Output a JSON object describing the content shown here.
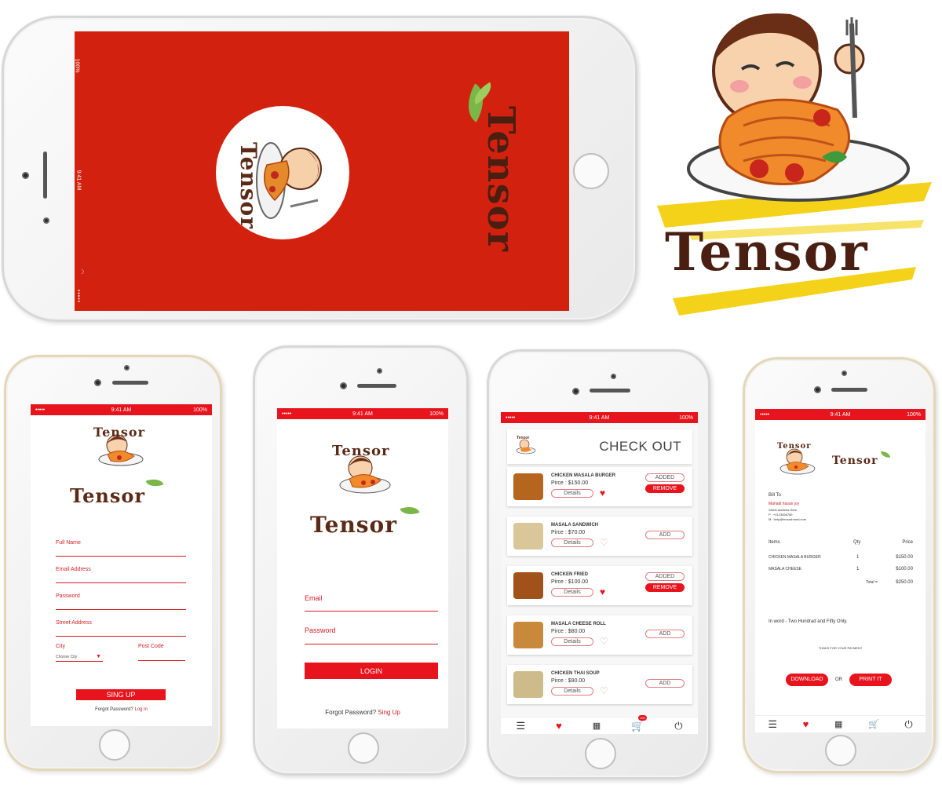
{
  "status": {
    "carrier": "•••••",
    "time": "9:41 AM",
    "battery": "100%"
  },
  "splash": {
    "circle_word": "Tensor",
    "brand": "Tensor"
  },
  "big_logo": {
    "brand": "Tensor"
  },
  "signup": {
    "brand": "Tensor",
    "small_logo_word": "Tensor",
    "fields": {
      "full_name": "Full Name",
      "email": "Email Address",
      "password": "Password",
      "street": "Street Address",
      "city": "City",
      "city_select": "Choose City",
      "post_code": "Post Code"
    },
    "button": "SING UP",
    "forgot_prefix": "Forgot Password?",
    "forgot_link": "Log in"
  },
  "login": {
    "brand": "Tensor",
    "small_logo_word": "Tensor",
    "fields": {
      "email": "Email",
      "password": "Password"
    },
    "button": "LOGIN",
    "forgot_prefix": "Forgot Password?",
    "forgot_link": "Sing Up"
  },
  "checkout": {
    "title": "CHECK OUT",
    "logo_word": "Tensor",
    "details_label": "Details",
    "cart_badge": "100",
    "items": [
      {
        "name": "CHICKEN MASALA BURGER",
        "price": "Pirce : $150.00",
        "state": "added",
        "btn1": "ADDED",
        "btn2": "REMOVE",
        "liked": true,
        "thumb": "#b5651d"
      },
      {
        "name": "MASALA SANDWICH",
        "price": "Pirce : $70.00",
        "state": "add",
        "btn1": "ADD",
        "liked": false,
        "thumb": "#d9c79a"
      },
      {
        "name": "CHICKEN FRIED",
        "price": "Pirce : $100.00",
        "state": "added",
        "btn1": "ADDED",
        "btn2": "REMOVE",
        "liked": true,
        "thumb": "#a0521a"
      },
      {
        "name": "MASALA CHEESE ROLL",
        "price": "Pirce : $80.00",
        "state": "add",
        "btn1": "ADD",
        "liked": false,
        "thumb": "#c88a3a"
      },
      {
        "name": "CHICKEN THAI SOUP",
        "price": "Pirce : $90.00",
        "state": "add",
        "btn1": "ADD",
        "liked": false,
        "thumb": "#cdbb8a"
      }
    ]
  },
  "invoice": {
    "brand": "Tensor",
    "small_logo_word": "Tensor",
    "bill_to": "Bill To",
    "customer": "Mahadi hasan joy",
    "address": "Street Address Here,",
    "phone": "P : +0123456789",
    "mail": "M : help@ferozahmed.com",
    "headers": {
      "items": "Items",
      "qty": "Qty",
      "price": "Price"
    },
    "rows": [
      {
        "item": "CHICKEN MASALA BURGER",
        "qty": "1",
        "price": "$150.00"
      },
      {
        "item": "MASALA CHEESE",
        "qty": "1",
        "price": "$100.00"
      }
    ],
    "total_label": "Total =",
    "total": "$250.00",
    "in_word": "In word - Two Hundrad and Fifty Only.",
    "thanks": "THNKS FOR YOUR PAYMENT",
    "download": "DOWNLOAD",
    "or": "OR",
    "print": "PRINT IT"
  },
  "colors": {
    "brand_red": "#e8141d",
    "brand_brown": "#5a2a16",
    "leaf_green": "#7ab648"
  }
}
